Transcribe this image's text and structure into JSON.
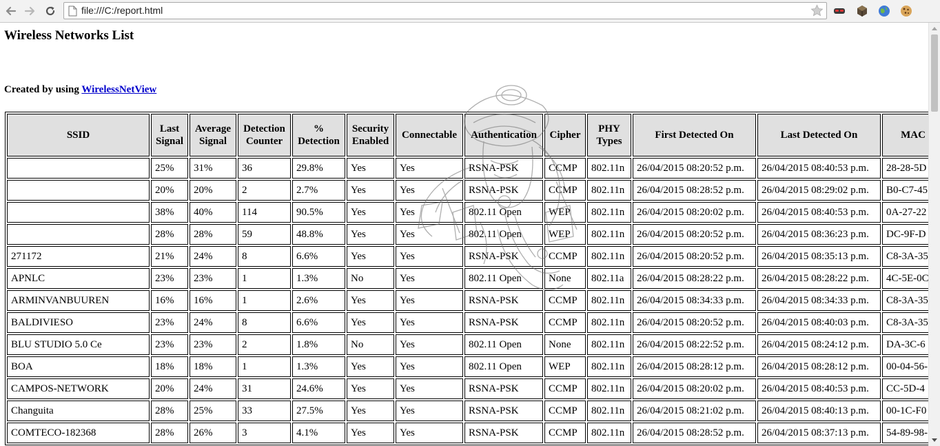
{
  "browser": {
    "url": "file:///C:/report.html"
  },
  "page": {
    "title": "Wireless Networks List",
    "credit_prefix": "Created by using ",
    "credit_link": "WirelessNetView"
  },
  "table": {
    "columns": [
      {
        "key": "ssid",
        "label": "SSID",
        "width": 207
      },
      {
        "key": "last",
        "label": "Last\nSignal",
        "width": 54
      },
      {
        "key": "avg",
        "label": "Average\nSignal",
        "width": 68
      },
      {
        "key": "counter",
        "label": "Detection\nCounter",
        "width": 77
      },
      {
        "key": "pct",
        "label": "%\nDetection",
        "width": 77
      },
      {
        "key": "security",
        "label": "Security\nEnabled",
        "width": 69
      },
      {
        "key": "connectable",
        "label": "Connectable",
        "width": 98
      },
      {
        "key": "auth",
        "label": "Authentication",
        "width": 114
      },
      {
        "key": "cipher",
        "label": "Cipher",
        "width": 60
      },
      {
        "key": "phy",
        "label": "PHY\nTypes",
        "width": 64
      },
      {
        "key": "first",
        "label": "First Detected On",
        "width": 179
      },
      {
        "key": "lastdet",
        "label": "Last Detected On",
        "width": 179
      },
      {
        "key": "mac",
        "label": "MAC",
        "width": 90
      }
    ],
    "rows": [
      [
        "",
        "25%",
        "31%",
        "36",
        "29.8%",
        "Yes",
        "Yes",
        "RSNA-PSK",
        "CCMP",
        "802.11n",
        "26/04/2015 08:20:52 p.m.",
        "26/04/2015 08:40:53 p.m.",
        "28-28-5D"
      ],
      [
        "",
        "20%",
        "20%",
        "2",
        "2.7%",
        "Yes",
        "Yes",
        "RSNA-PSK",
        "CCMP",
        "802.11n",
        "26/04/2015 08:28:52 p.m.",
        "26/04/2015 08:29:02 p.m.",
        "B0-C7-45"
      ],
      [
        "",
        "38%",
        "40%",
        "114",
        "90.5%",
        "Yes",
        "Yes",
        "802.11 Open",
        "WEP",
        "802.11n",
        "26/04/2015 08:20:02 p.m.",
        "26/04/2015 08:40:53 p.m.",
        "0A-27-22"
      ],
      [
        "",
        "28%",
        "28%",
        "59",
        "48.8%",
        "Yes",
        "Yes",
        "802.11 Open",
        "WEP",
        "802.11n",
        "26/04/2015 08:20:52 p.m.",
        "26/04/2015 08:36:23 p.m.",
        "DC-9F-D"
      ],
      [
        "271172",
        "21%",
        "24%",
        "8",
        "6.6%",
        "Yes",
        "Yes",
        "RSNA-PSK",
        "CCMP",
        "802.11n",
        "26/04/2015 08:20:52 p.m.",
        "26/04/2015 08:35:13 p.m.",
        "C8-3A-35"
      ],
      [
        "APNLC",
        "23%",
        "23%",
        "1",
        "1.3%",
        "No",
        "Yes",
        "802.11 Open",
        "None",
        "802.11a",
        "26/04/2015 08:28:22 p.m.",
        "26/04/2015 08:28:22 p.m.",
        "4C-5E-0C"
      ],
      [
        "ARMINVANBUUREN",
        "16%",
        "16%",
        "1",
        "2.6%",
        "Yes",
        "Yes",
        "RSNA-PSK",
        "CCMP",
        "802.11n",
        "26/04/2015 08:34:33 p.m.",
        "26/04/2015 08:34:33 p.m.",
        "C8-3A-35"
      ],
      [
        "BALDIVIESO",
        "23%",
        "24%",
        "8",
        "6.6%",
        "Yes",
        "Yes",
        "RSNA-PSK",
        "CCMP",
        "802.11n",
        "26/04/2015 08:20:52 p.m.",
        "26/04/2015 08:40:03 p.m.",
        "C8-3A-35"
      ],
      [
        "BLU STUDIO 5.0 Ce",
        "23%",
        "23%",
        "2",
        "1.8%",
        "No",
        "Yes",
        "802.11 Open",
        "None",
        "802.11n",
        "26/04/2015 08:22:52 p.m.",
        "26/04/2015 08:24:12 p.m.",
        "DA-3C-6"
      ],
      [
        "BOA",
        "18%",
        "18%",
        "1",
        "1.3%",
        "Yes",
        "Yes",
        "802.11 Open",
        "WEP",
        "802.11n",
        "26/04/2015 08:28:12 p.m.",
        "26/04/2015 08:28:12 p.m.",
        "00-04-56-"
      ],
      [
        "CAMPOS-NETWORK",
        "20%",
        "24%",
        "31",
        "24.6%",
        "Yes",
        "Yes",
        "RSNA-PSK",
        "CCMP",
        "802.11n",
        "26/04/2015 08:20:02 p.m.",
        "26/04/2015 08:40:53 p.m.",
        "CC-5D-4"
      ],
      [
        "Changuita",
        "28%",
        "25%",
        "33",
        "27.5%",
        "Yes",
        "Yes",
        "RSNA-PSK",
        "CCMP",
        "802.11n",
        "26/04/2015 08:21:02 p.m.",
        "26/04/2015 08:40:13 p.m.",
        "00-1C-F0"
      ],
      [
        "COMTECO-182368",
        "28%",
        "26%",
        "3",
        "4.1%",
        "Yes",
        "Yes",
        "RSNA-PSK",
        "CCMP",
        "802.11n",
        "26/04/2015 08:28:52 p.m.",
        "26/04/2015 08:37:13 p.m.",
        "54-89-98-"
      ]
    ]
  },
  "colors": {
    "header_bg": "#e0e0e0",
    "link": "#0000cc",
    "chrome_bg": "#f2f2f2"
  }
}
